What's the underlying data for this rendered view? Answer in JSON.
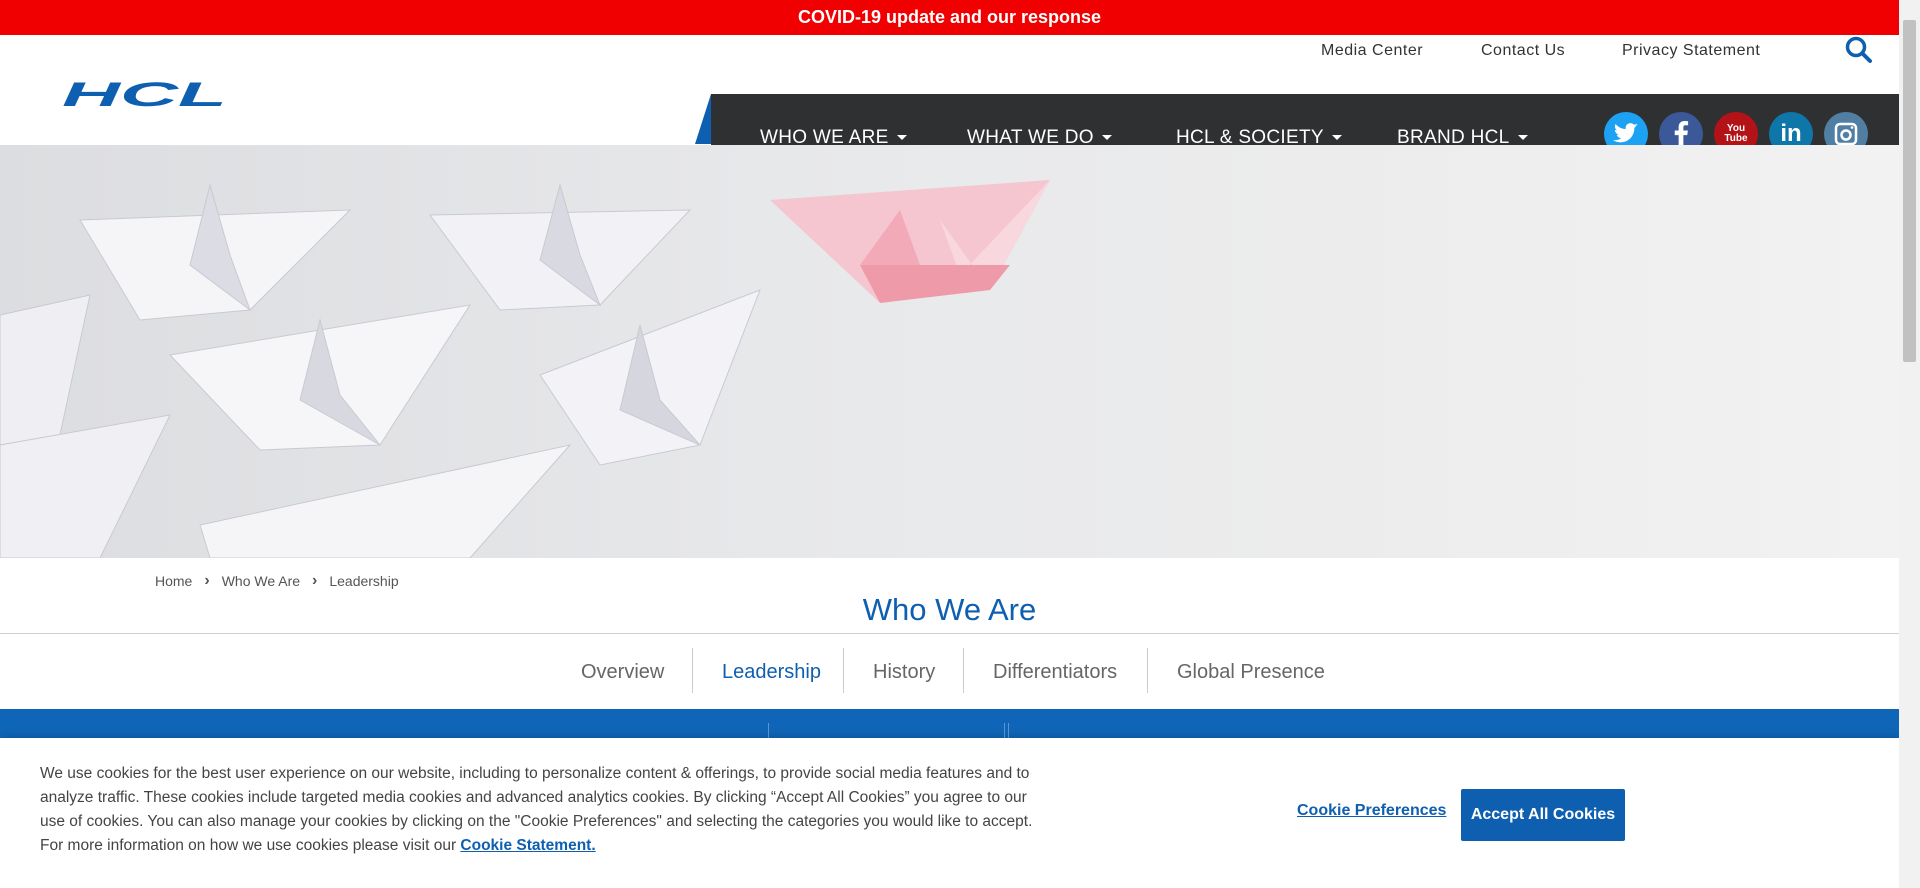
{
  "banner": {
    "text": "COVID-19 update and our response"
  },
  "utility_links": [
    "Media Center",
    "Contact Us",
    "Privacy Statement"
  ],
  "logo": {
    "text": "HCL"
  },
  "nav": [
    {
      "label": "WHO WE ARE"
    },
    {
      "label": "WHAT WE DO"
    },
    {
      "label": "HCL & SOCIETY"
    },
    {
      "label": "BRAND HCL"
    }
  ],
  "social": [
    {
      "icon": "twitter-icon",
      "color": "#1da1f2"
    },
    {
      "icon": "facebook-icon",
      "color": "#3b5998"
    },
    {
      "icon": "youtube-icon",
      "color": "#b31217",
      "text": "You Tube"
    },
    {
      "icon": "linkedin-icon",
      "color": "#0e76a8",
      "text": "in"
    },
    {
      "icon": "instagram-icon",
      "color": "#517fa4"
    }
  ],
  "breadcrumb": [
    "Home",
    "Who We Are",
    "Leadership"
  ],
  "section_title": "Who We Are",
  "tabs": [
    {
      "label": "Overview"
    },
    {
      "label": "Leadership",
      "active": true
    },
    {
      "label": "History"
    },
    {
      "label": "Differentiators"
    },
    {
      "label": "Global Presence"
    }
  ],
  "cookie": {
    "text": "We use cookies for the best user experience on our website, including to personalize content & offerings, to provide social media features and to analyze traffic. These cookies include targeted media cookies and advanced analytics cookies. By clicking “Accept All Cookies” you agree to our use of cookies. You can also manage your cookies by clicking on the \"Cookie Preferences\" and selecting the categories you would like to accept. For more information on how we use cookies please visit our",
    "link": "Cookie Statement.",
    "preferences": "Cookie Preferences",
    "accept": "Accept All Cookies"
  },
  "colors": {
    "brand_blue": "#0f5fb0",
    "banner_red": "#f00000",
    "nav_dark": "#2f3032"
  }
}
